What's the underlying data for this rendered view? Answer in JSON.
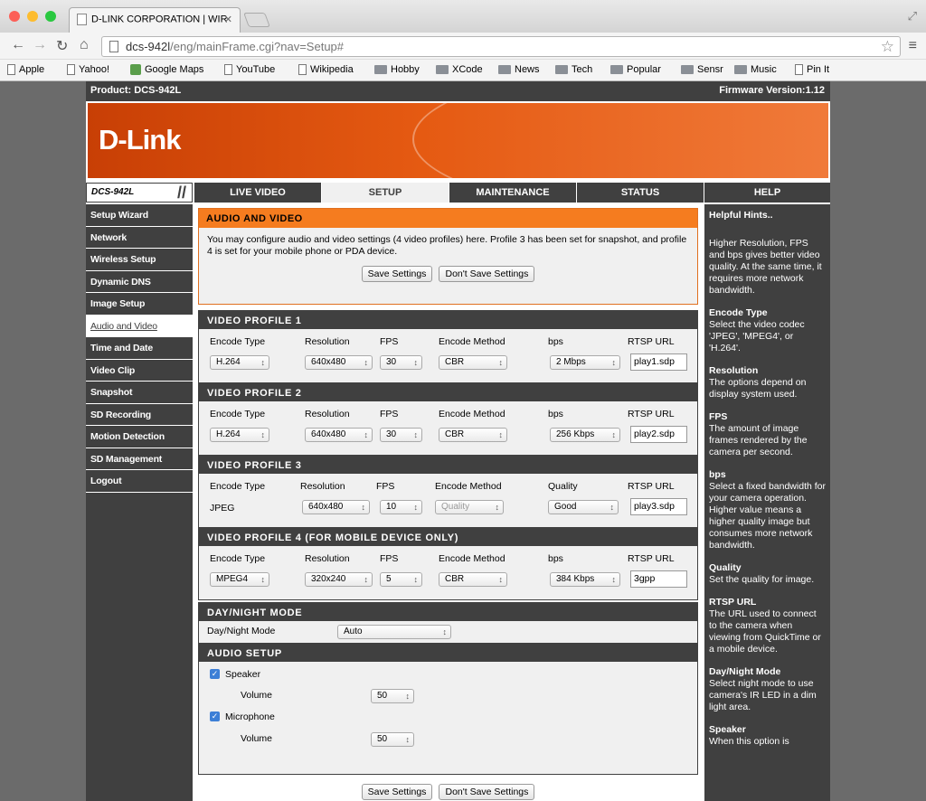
{
  "browser": {
    "tab_title": "D-LINK CORPORATION | WIR",
    "url_host": "dcs-942l",
    "url_path": "/eng/mainFrame.cgi?nav=Setup#",
    "bookmarks": [
      "Apple",
      "Yahoo!",
      "Google Maps",
      "YouTube",
      "Wikipedia",
      "Hobby",
      "XCode",
      "News",
      "Tech",
      "Popular",
      "Sensr",
      "Music",
      "Pin It"
    ]
  },
  "header": {
    "product": "Product: DCS-942L",
    "firmware": "Firmware Version:1.12",
    "logo": "D-Link",
    "model": "DCS-942L"
  },
  "nav_tabs": [
    "LIVE VIDEO",
    "SETUP",
    "MAINTENANCE",
    "STATUS"
  ],
  "help_tab": "HELP",
  "sidebar": [
    "Setup Wizard",
    "Network",
    "Wireless Setup",
    "Dynamic DNS",
    "Image Setup",
    "Audio and Video",
    "Time and Date",
    "Video Clip",
    "Snapshot",
    "SD Recording",
    "Motion Detection",
    "SD Management",
    "Logout"
  ],
  "intro": {
    "title": "AUDIO AND VIDEO",
    "description": "You may configure audio and video settings (4 video profiles) here. Profile 3 has been set for snapshot, and profile 4 is set for your mobile phone or PDA device.",
    "save": "Save Settings",
    "dont_save": "Don't Save Settings"
  },
  "profiles": [
    {
      "title": "VIDEO PROFILE 1",
      "labels": [
        "Encode Type",
        "Resolution",
        "FPS",
        "Encode Method",
        "bps",
        "RTSP URL"
      ],
      "encode": "H.264",
      "resolution": "640x480",
      "fps": "30",
      "method": "CBR",
      "rate": "2 Mbps",
      "url": "play1.sdp"
    },
    {
      "title": "VIDEO PROFILE 2",
      "labels": [
        "Encode Type",
        "Resolution",
        "FPS",
        "Encode Method",
        "bps",
        "RTSP URL"
      ],
      "encode": "H.264",
      "resolution": "640x480",
      "fps": "30",
      "method": "CBR",
      "rate": "256 Kbps",
      "url": "play2.sdp"
    },
    {
      "title": "VIDEO PROFILE 3",
      "labels": [
        "Encode Type",
        "Resolution",
        "FPS",
        "Encode Method",
        "Quality",
        "RTSP URL"
      ],
      "encode": "JPEG",
      "resolution": "640x480",
      "fps": "10",
      "method": "Quality",
      "rate": "Good",
      "url": "play3.sdp"
    },
    {
      "title": "VIDEO PROFILE 4 (FOR MOBILE DEVICE ONLY)",
      "labels": [
        "Encode Type",
        "Resolution",
        "FPS",
        "Encode Method",
        "bps",
        "RTSP URL"
      ],
      "encode": "MPEG4",
      "resolution": "320x240",
      "fps": "5",
      "method": "CBR",
      "rate": "384 Kbps",
      "url": "3gpp"
    }
  ],
  "daynight": {
    "title": "DAY/NIGHT MODE",
    "label": "Day/Night Mode",
    "value": "Auto"
  },
  "audio": {
    "title": "AUDIO SETUP",
    "speaker": "Speaker",
    "microphone": "Microphone",
    "volume_label": "Volume",
    "speaker_volume": "50",
    "mic_volume": "50",
    "speaker_checked": true,
    "mic_checked": true
  },
  "bottom": {
    "save": "Save Settings",
    "dont_save": "Don't Save Settings"
  },
  "help": [
    {
      "h": "Helpful Hints..",
      "t": ""
    },
    {
      "h": "",
      "t": "Higher Resolution, FPS and bps gives better video quality. At the same time, it requires more network bandwidth."
    },
    {
      "h": "Encode Type",
      "t": "Select the video codec 'JPEG', 'MPEG4', or 'H.264'."
    },
    {
      "h": "Resolution",
      "t": "The options depend on display system used."
    },
    {
      "h": "FPS",
      "t": "The amount of image frames rendered by the camera per second."
    },
    {
      "h": "bps",
      "t": "Select a fixed bandwidth for your camera operation. Higher value means a higher quality image but consumes more network bandwidth."
    },
    {
      "h": "Quality",
      "t": "Set the quality for image."
    },
    {
      "h": "RTSP URL",
      "t": "The URL used to connect to the camera when viewing from QuickTime or a mobile device."
    },
    {
      "h": "Day/Night Mode",
      "t": "Select night mode to use camera's IR LED in a dim light area."
    },
    {
      "h": "Speaker",
      "t": "When this option is"
    }
  ]
}
